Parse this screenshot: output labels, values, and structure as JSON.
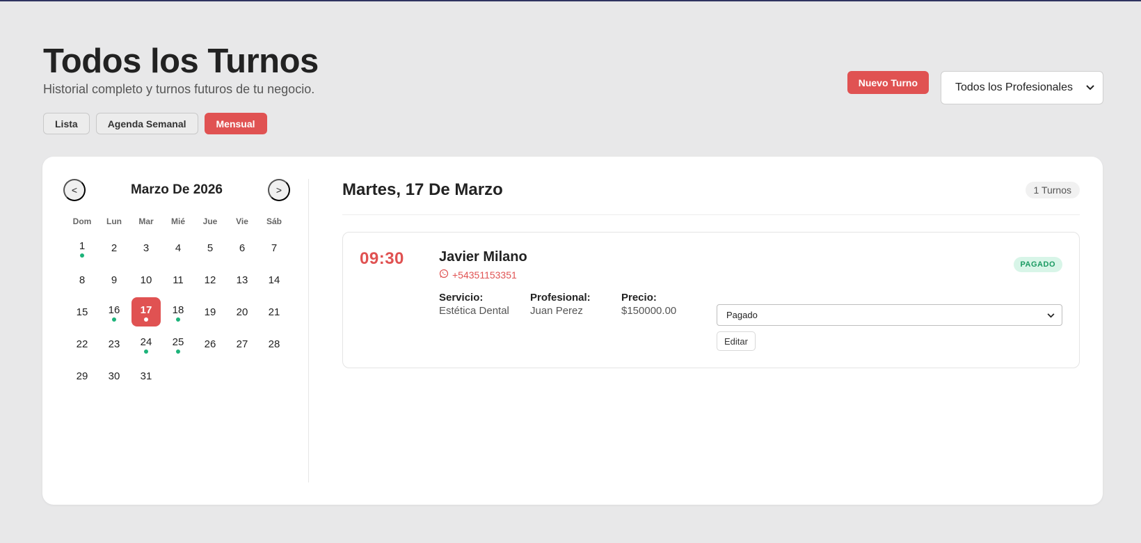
{
  "header": {
    "title": "Todos los Turnos",
    "subtitle": "Historial completo y turnos futuros de tu negocio."
  },
  "view_tabs": [
    {
      "label": "Lista",
      "active": false
    },
    {
      "label": "Agenda Semanal",
      "active": false
    },
    {
      "label": "Mensual",
      "active": true
    }
  ],
  "actions": {
    "new_label": "Nuevo Turno",
    "professional_filter": "Todos los Profesionales"
  },
  "calendar": {
    "prev": "<",
    "next": ">",
    "month_label": "Marzo De 2026",
    "weekdays": [
      "Dom",
      "Lun",
      "Mar",
      "Mié",
      "Jue",
      "Vie",
      "Sáb"
    ],
    "selected_day": "17",
    "days_with_appointments": [
      "1",
      "16",
      "17",
      "18",
      "24",
      "25"
    ],
    "days": [
      "1",
      "2",
      "3",
      "4",
      "5",
      "6",
      "7",
      "8",
      "9",
      "10",
      "11",
      "12",
      "13",
      "14",
      "15",
      "16",
      "17",
      "18",
      "19",
      "20",
      "21",
      "22",
      "23",
      "24",
      "25",
      "26",
      "27",
      "28",
      "29",
      "30",
      "31"
    ]
  },
  "detail": {
    "title": "Martes, 17 De Marzo",
    "count": "1 Turnos",
    "appointment": {
      "time": "09:30",
      "client": "Javier Milano",
      "phone": "+54351153351",
      "status_badge": "PAGADO",
      "service_label": "Servicio:",
      "service_value": "Estética Dental",
      "professional_label": "Profesional:",
      "professional_value": "Juan Perez",
      "price_label": "Precio:",
      "price_value": "$150000.00",
      "status_select": "Pagado",
      "edit_label": "Editar"
    }
  },
  "colors": {
    "accent": "#e05252",
    "dot": "#1db37a",
    "background": "#e8e8e9"
  }
}
